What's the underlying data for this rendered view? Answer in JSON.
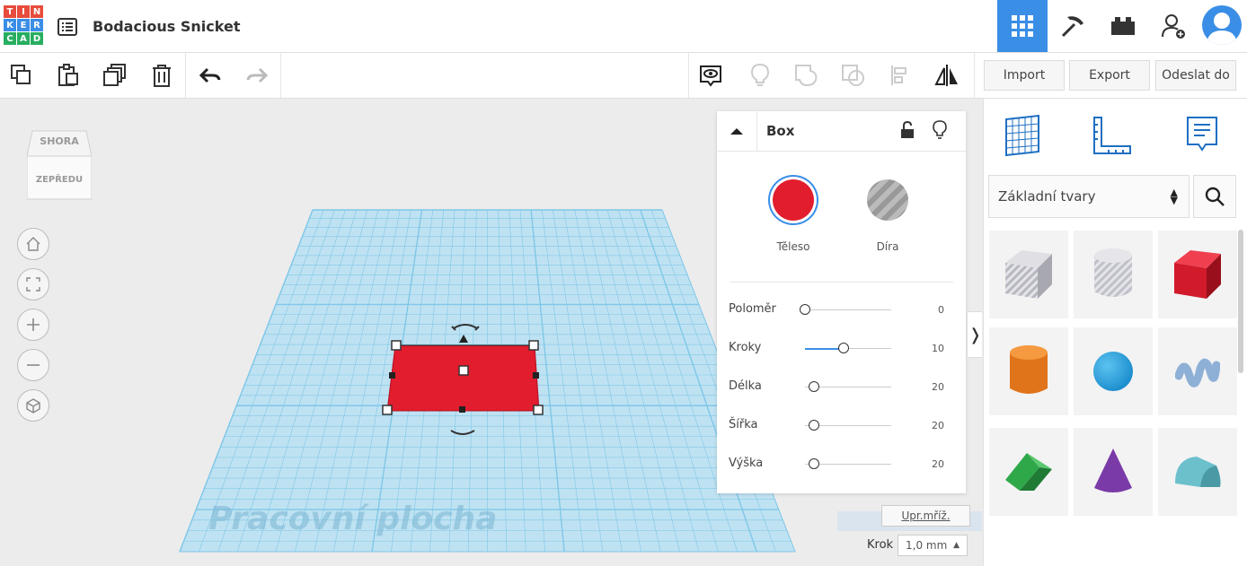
{
  "app": {
    "logo_letters": [
      "T",
      "I",
      "N",
      "K",
      "E",
      "R",
      "C",
      "A",
      "D"
    ],
    "logo_colors": [
      "#e74c3c",
      "#e74c3c",
      "#e74c3c",
      "#3a8ee6",
      "#3a8ee6",
      "#3a8ee6",
      "#27ae60",
      "#27ae60",
      "#27ae60"
    ],
    "project_title": "Bodacious Snicket"
  },
  "top_right": {
    "icons": [
      "grid-view-icon",
      "pickaxe-icon",
      "brick-icon",
      "add-user-icon",
      "avatar-icon"
    ],
    "accent": "#3a8ee6"
  },
  "toolbar": {
    "left_icons": [
      "copy-icon",
      "paste-icon",
      "duplicate-icon",
      "delete-icon",
      "undo-icon",
      "redo-icon"
    ],
    "mid_icons": [
      "view-icon",
      "light-icon",
      "group-icon",
      "ungroup-icon",
      "align-icon",
      "mirror-icon"
    ],
    "import_label": "Import",
    "export_label": "Export",
    "send_label": "Odeslat do"
  },
  "viewcube": {
    "top_label": "SHORA",
    "front_label": "ZEPŘEDU"
  },
  "workplane": {
    "label": "Pracovní plocha",
    "grid_color": "#7fc7e8",
    "shape_color": "#e11d2e"
  },
  "inspector": {
    "shape_name": "Box",
    "solid_label": "Těleso",
    "hole_label": "Díra",
    "solid_color": "#e11d2e",
    "params": [
      {
        "label": "Poloměr",
        "value": "0",
        "fraction": 0.0
      },
      {
        "label": "Kroky",
        "value": "10",
        "fraction": 0.45
      },
      {
        "label": "Délka",
        "value": "20",
        "fraction": 0.1
      },
      {
        "label": "Šířka",
        "value": "20",
        "fraction": 0.1
      },
      {
        "label": "Výška",
        "value": "20",
        "fraction": 0.1
      }
    ]
  },
  "grid_controls": {
    "edit_grid_label": "Upr.mříž.",
    "step_label": "Krok",
    "step_value": "1,0 mm"
  },
  "right_panel": {
    "tabs": [
      "workplane-grid-icon",
      "ruler-icon",
      "notes-icon"
    ],
    "category": "Základní tvary",
    "shapes": [
      {
        "name": "box-hole-shape",
        "color": "#b8b8c0"
      },
      {
        "name": "cylinder-hole-shape",
        "color": "#c0c0c8"
      },
      {
        "name": "box-shape",
        "color": "#d11a2a"
      },
      {
        "name": "cylinder-shape",
        "color": "#e0741a"
      },
      {
        "name": "sphere-shape",
        "color": "#1a8ccc"
      },
      {
        "name": "scribble-shape",
        "color": "#8fb0d6"
      },
      {
        "name": "roof-shape",
        "color": "#2fa84a"
      },
      {
        "name": "cone-shape",
        "color": "#7a3aa8"
      },
      {
        "name": "round-roof-shape",
        "color": "#6cc0cc"
      }
    ]
  }
}
